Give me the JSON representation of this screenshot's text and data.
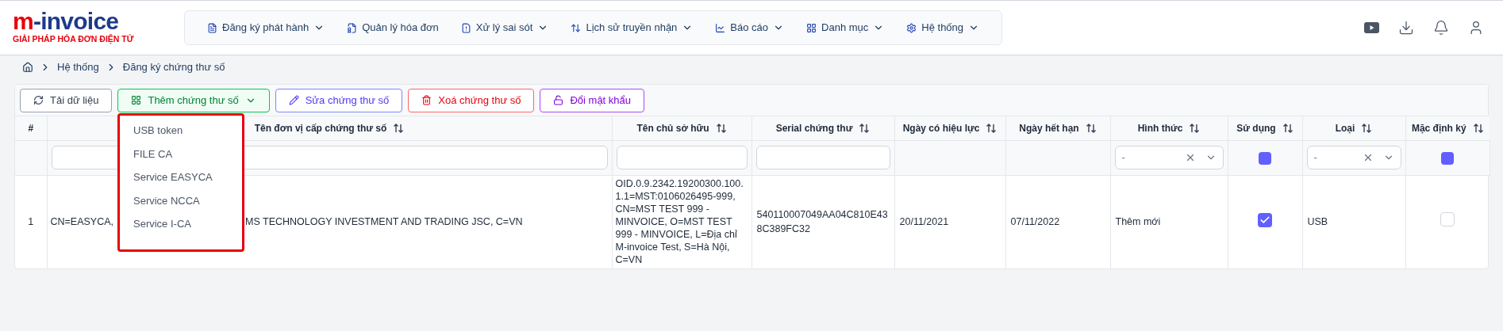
{
  "logo": {
    "mark": "m",
    "name": "-invoice",
    "tagline": "GIẢI PHÁP HÓA ĐƠN ĐIỆN TỬ"
  },
  "nav": [
    {
      "label": "Đăng ký phát hành",
      "has_menu": true
    },
    {
      "label": "Quản lý hóa đơn",
      "has_menu": false
    },
    {
      "label": "Xử lý sai sót",
      "has_menu": true
    },
    {
      "label": "Lịch sử truyền nhận",
      "has_menu": true
    },
    {
      "label": "Báo cáo",
      "has_menu": true
    },
    {
      "label": "Danh mục",
      "has_menu": true
    },
    {
      "label": "Hệ thống",
      "has_menu": true
    }
  ],
  "breadcrumb": [
    "Hệ thống",
    "Đăng ký chứng thư số"
  ],
  "toolbar": [
    {
      "label": "Tải dữ liệu",
      "kind": "refresh",
      "has_menu": false
    },
    {
      "label": "Thêm chứng thư số",
      "kind": "add",
      "has_menu": true
    },
    {
      "label": "Sửa chứng thư số",
      "kind": "edit",
      "has_menu": false
    },
    {
      "label": "Xoá chứng thư số",
      "kind": "delete",
      "has_menu": false
    },
    {
      "label": "Đổi mật khẩu",
      "kind": "password",
      "has_menu": false
    }
  ],
  "add_menu": [
    "USB token",
    "FILE CA",
    "Service EASYCA",
    "Service NCCA",
    "Service I-CA"
  ],
  "table": {
    "columns": [
      {
        "label": "#",
        "sortable": false
      },
      {
        "label": "Tên đơn vị cấp chứng thư số",
        "sortable": true,
        "filter": {
          "kind": "text"
        }
      },
      {
        "label": "Tên chủ sở hữu",
        "sortable": true,
        "filter": {
          "kind": "text"
        }
      },
      {
        "label": "Serial chứng thư",
        "sortable": true,
        "filter": {
          "kind": "text"
        }
      },
      {
        "label": "Ngày có hiệu lực",
        "sortable": true
      },
      {
        "label": "Ngày hết hạn",
        "sortable": true
      },
      {
        "label": "Hình thức",
        "sortable": true,
        "filter": {
          "kind": "select",
          "value": "-"
        }
      },
      {
        "label": "Sử dụng",
        "sortable": true,
        "filter": {
          "kind": "checkbox",
          "checked": true
        }
      },
      {
        "label": "Loại",
        "sortable": true,
        "filter": {
          "kind": "select",
          "value": "-"
        }
      },
      {
        "label": "Mặc định ký",
        "sortable": true,
        "filter": {
          "kind": "checkbox",
          "checked": true
        }
      }
    ],
    "rows": [
      {
        "index": "1",
        "issuer_parts": [
          "CN=EASYCA,",
          "MS TECHNOLOGY INVESTMENT AND TRADING JSC, C=VN"
        ],
        "owner": "OID.0.9.2342.19200300.100.1.1=MST:0106026495-999, CN=MST TEST 999 - MINVOICE, O=MST TEST 999 - MINVOICE, L=Địa chỉ M-invoice Test, S=Hà Nội, C=VN",
        "serial": "540110007049AA04C810E438C389FC32",
        "valid_from": "20/11/2021",
        "valid_to": "07/11/2022",
        "form": "Thêm mới",
        "in_use": true,
        "type": "USB",
        "default_sign": false
      }
    ]
  }
}
